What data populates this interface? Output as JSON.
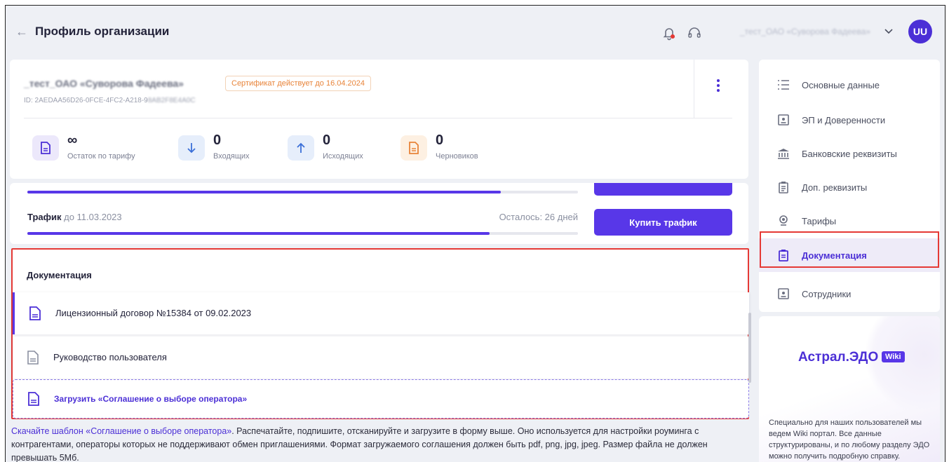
{
  "header": {
    "back_icon": "←",
    "title": "Профиль организации",
    "org_selector": "_тест_ОАО «Суворова Фадеева»",
    "avatar_initials": "UU"
  },
  "org_card": {
    "name": "_тест_ОАО «Суворова Фадеева»",
    "id_visible": "ID: 2AEDAA56D26-0FCE-4FC2-A218-9",
    "id_masked": "8AB2F8E4A0C",
    "certificate_badge": "Сертификат действует до 16.04.2024",
    "stats": [
      {
        "icon": "document-icon",
        "value": "∞",
        "label": "Остаток по тарифу"
      },
      {
        "icon": "arrow-down-icon",
        "value": "0",
        "label": "Входящих"
      },
      {
        "icon": "arrow-up-icon",
        "value": "0",
        "label": "Исходящих"
      },
      {
        "icon": "draft-icon",
        "value": "0",
        "label": "Черновиков"
      }
    ]
  },
  "tariff": {
    "label_bold": "Трафик",
    "label_rest": " до 11.03.2023",
    "remaining": "Осталось: 26 дней",
    "buy_button": "Купить трафик",
    "progress": 0.84
  },
  "documentation": {
    "title": "Документация",
    "items": [
      {
        "label": "Лицензионный договор №15384 от 09.02.2023",
        "active": true
      },
      {
        "label": "Руководство пользователя",
        "active": false
      }
    ],
    "upload_label": "Загрузить «Соглашение о выборе оператора»"
  },
  "note": {
    "link": "Скачайте шаблон «Соглашение о выборе оператора»",
    "text": ". Распечатайте, подпишите, отсканируйте и загрузите в форму выше. Оно используется для настройки роуминга с контрагентами, операторы которых не поддерживают обмен приглашениями. Формат загружаемого соглашения должен быть pdf, png, jpg, jpeg. Размер файла не должен превышать 5Мб."
  },
  "sidebar": {
    "items": [
      {
        "label": "Основные данные",
        "icon": "list-icon"
      },
      {
        "label": "ЭП и Доверенности",
        "icon": "id-card-icon"
      },
      {
        "label": "Банковские реквизиты",
        "icon": "bank-icon"
      },
      {
        "label": "Доп. реквизиты",
        "icon": "clipboard-icon"
      },
      {
        "label": "Тарифы",
        "icon": "badge-icon"
      },
      {
        "label": "Документация",
        "icon": "clipboard-doc-icon",
        "active": true
      },
      {
        "label": "Сотрудники",
        "icon": "id-card-icon"
      }
    ]
  },
  "wiki": {
    "title": "Астрал.ЭДО",
    "tag": "Wiki",
    "text": "Специально для наших пользователей мы ведем Wiki портал. Все данные структурированы, и по любому разделу ЭДО можно получить подробную справку."
  },
  "colors": {
    "accent": "#5837e8",
    "highlight": "#e53935",
    "certificate": "#e8843a"
  }
}
